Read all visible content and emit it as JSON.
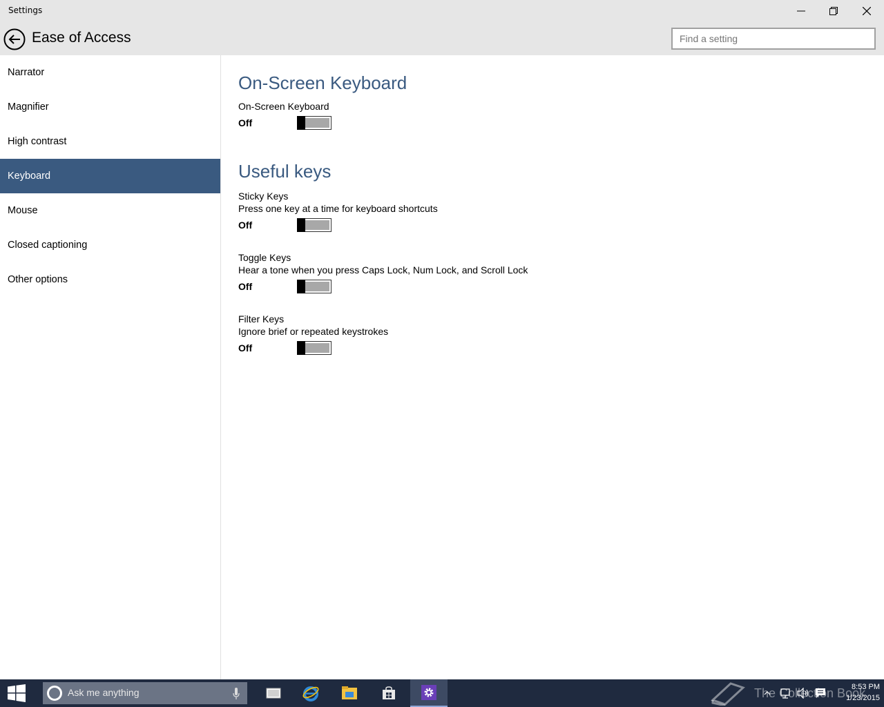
{
  "window": {
    "title": "Settings"
  },
  "header": {
    "title": "Ease of Access",
    "search_placeholder": "Find a setting"
  },
  "sidebar": {
    "items": [
      {
        "label": "Narrator",
        "selected": false
      },
      {
        "label": "Magnifier",
        "selected": false
      },
      {
        "label": "High contrast",
        "selected": false
      },
      {
        "label": "Keyboard",
        "selected": true
      },
      {
        "label": "Mouse",
        "selected": false
      },
      {
        "label": "Closed captioning",
        "selected": false
      },
      {
        "label": "Other options",
        "selected": false
      }
    ]
  },
  "content": {
    "section1": {
      "title": "On-Screen Keyboard",
      "settings": [
        {
          "label": "On-Screen Keyboard",
          "description": "",
          "state": "Off"
        }
      ]
    },
    "section2": {
      "title": "Useful keys",
      "settings": [
        {
          "label": "Sticky Keys",
          "description": "Press one key at a time for keyboard shortcuts",
          "state": "Off"
        },
        {
          "label": "Toggle Keys",
          "description": "Hear a tone when you press Caps Lock, Num Lock, and Scroll Lock",
          "state": "Off"
        },
        {
          "label": "Filter Keys",
          "description": "Ignore brief or repeated keystrokes",
          "state": "Off"
        }
      ]
    }
  },
  "taskbar": {
    "search_placeholder": "Ask me anything",
    "watermark": "The Collection Book",
    "time": "8:53 PM",
    "date": "1/23/2015"
  },
  "colors": {
    "accent": "#3a5a80",
    "taskbar": "#1f2a3f",
    "chrome": "#e6e6e6"
  },
  "icons": {
    "back": "back-arrow-icon",
    "minimize": "minimize-icon",
    "maximize": "restore-icon",
    "close": "close-icon",
    "start": "windows-logo-icon",
    "cortana": "cortana-circle-icon",
    "mic": "microphone-icon",
    "task_view": "task-view-icon",
    "edge": "internet-explorer-icon",
    "explorer": "file-explorer-icon",
    "store": "store-icon",
    "settings": "gear-icon"
  }
}
